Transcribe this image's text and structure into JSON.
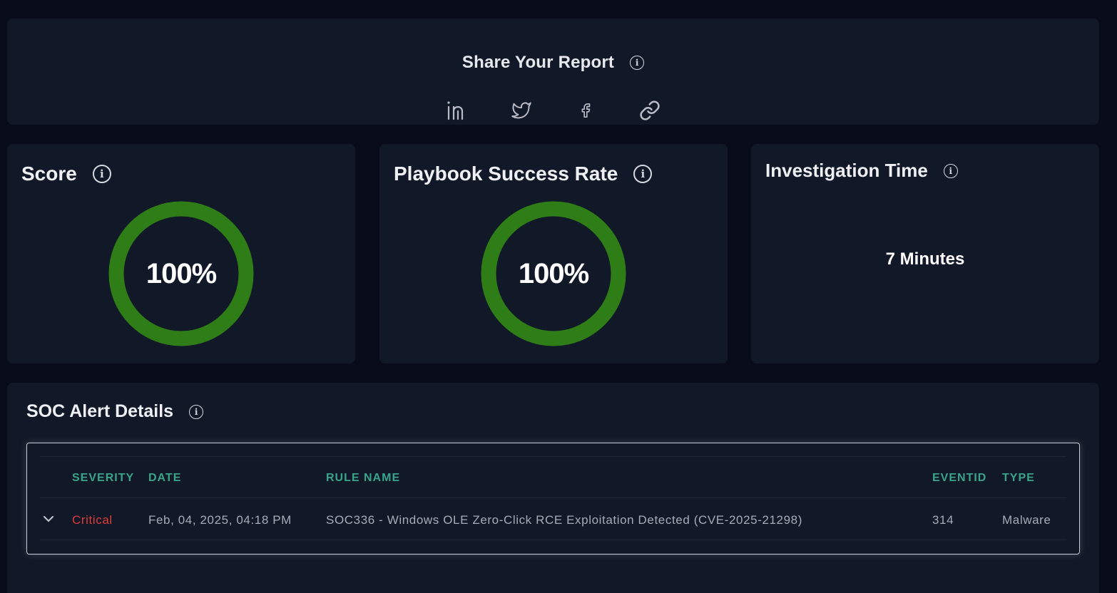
{
  "share": {
    "title": "Share Your Report",
    "icons": [
      "linkedin-icon",
      "twitter-icon",
      "facebook-icon",
      "link-icon"
    ]
  },
  "metrics": {
    "score": {
      "title": "Score",
      "value_label": "100%",
      "value": 1.0,
      "color": "#2f7d16"
    },
    "playbook": {
      "title": "Playbook Success Rate",
      "value_label": "100%",
      "value": 1.0,
      "color": "#2f7d16"
    },
    "investigation": {
      "title": "Investigation Time",
      "value": "7 Minutes"
    }
  },
  "soc": {
    "title": "SOC Alert Details",
    "columns": [
      "SEVERITY",
      "DATE",
      "RULE NAME",
      "EVENTID",
      "TYPE"
    ],
    "rows": [
      {
        "severity": "Critical",
        "date": "Feb, 04, 2025, 04:18 PM",
        "rule_name": "SOC336 - Windows OLE Zero-Click RCE Exploitation Detected (CVE-2025-21298)",
        "event_id": "314",
        "type": "Malware"
      }
    ]
  },
  "colors": {
    "background": "#080c1a",
    "card": "#111827",
    "accent_header": "#3aa48a",
    "critical": "#e03a3a",
    "donut": "#2f7d16"
  }
}
